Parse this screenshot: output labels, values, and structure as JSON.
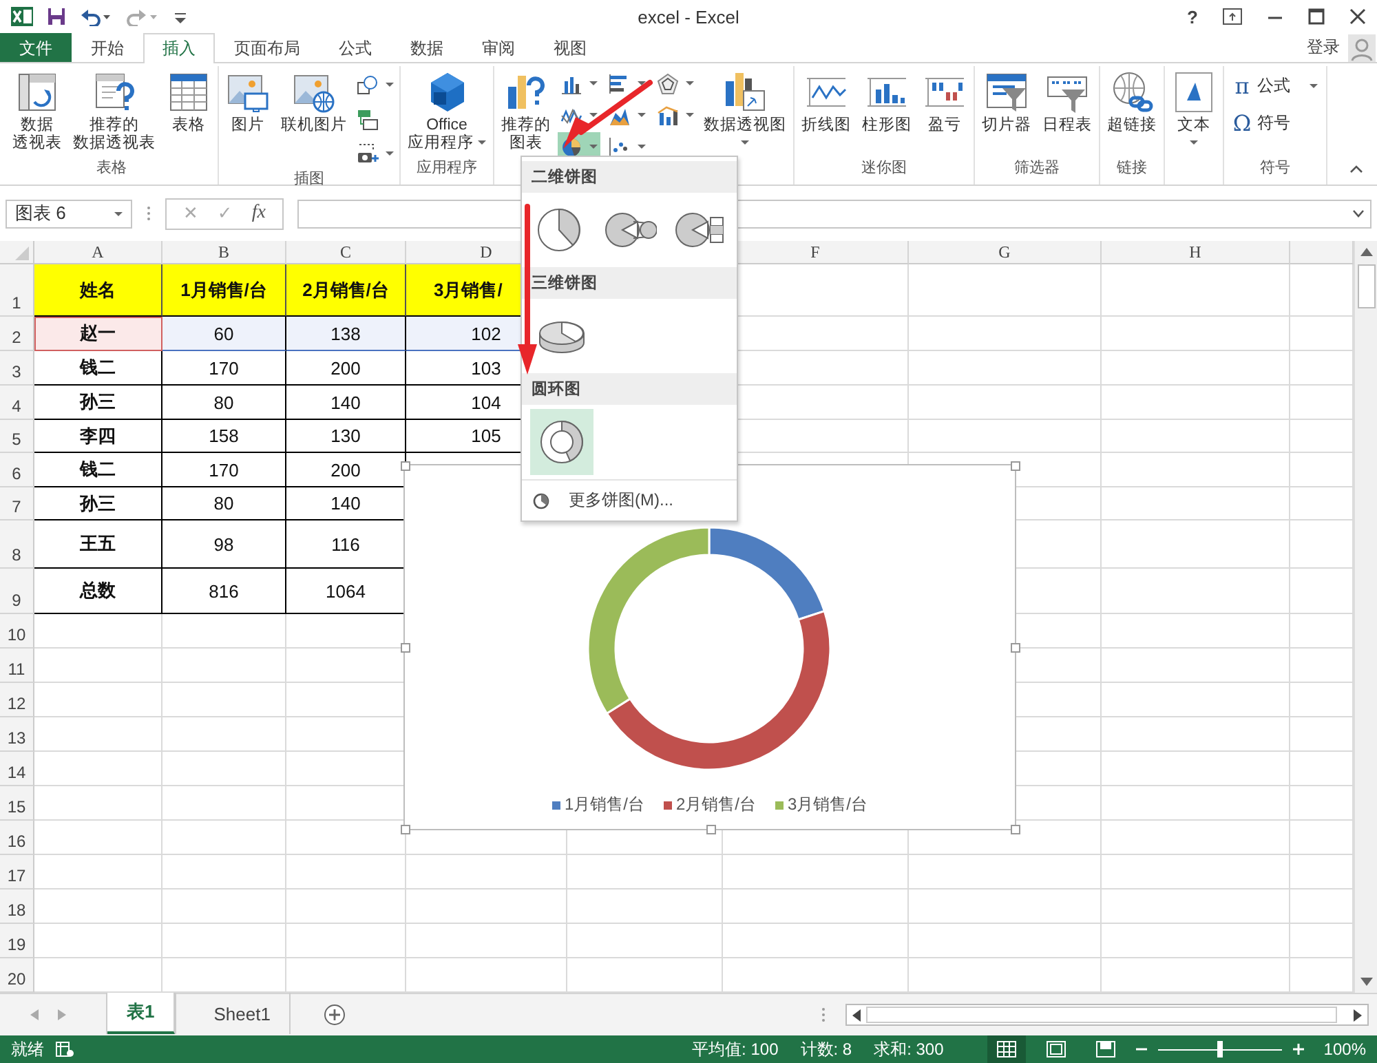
{
  "title_bar": {
    "title": "excel - Excel",
    "help": "?"
  },
  "tabs": [
    {
      "label": "文件",
      "kind": "file",
      "selected": false
    },
    {
      "label": "开始",
      "kind": "tab",
      "selected": false
    },
    {
      "label": "插入",
      "kind": "tab",
      "selected": true
    },
    {
      "label": "页面布局",
      "kind": "tab",
      "selected": false
    },
    {
      "label": "公式",
      "kind": "tab",
      "selected": false
    },
    {
      "label": "数据",
      "kind": "tab",
      "selected": false
    },
    {
      "label": "审阅",
      "kind": "tab",
      "selected": false
    },
    {
      "label": "视图",
      "kind": "tab",
      "selected": false
    }
  ],
  "account": {
    "label": "登录"
  },
  "ribbon": {
    "groups": [
      {
        "label": "表格",
        "controls": [
          {
            "kind": "large",
            "lines": [
              "数据",
              "透视表"
            ],
            "dropdown": false
          },
          {
            "kind": "large",
            "lines": [
              "推荐的",
              "数据透视表"
            ],
            "dropdown": false
          },
          {
            "kind": "large",
            "lines": [
              "表格"
            ],
            "dropdown": false
          }
        ]
      },
      {
        "label": "插图",
        "controls": [
          {
            "kind": "large",
            "lines": [
              "图片"
            ],
            "dropdown": false
          },
          {
            "kind": "large",
            "lines": [
              "联机图片"
            ],
            "dropdown": false
          },
          {
            "kind": "stack",
            "items": [
              {
                "dropdown": true,
                "selected": false
              },
              {
                "dropdown": false,
                "selected": false
              },
              {
                "dropdown": true,
                "selected": false
              }
            ]
          }
        ]
      },
      {
        "label": "应用程序",
        "controls": [
          {
            "kind": "large",
            "lines": [
              "Office",
              "应用程序"
            ],
            "dropdown": true
          }
        ]
      },
      {
        "controls": [
          {
            "kind": "large",
            "lines": [
              "推荐的",
              "图表"
            ],
            "dropdown": false
          },
          {
            "kind": "grid",
            "items": [
              {
                "dropdown": true,
                "selected": false
              },
              {
                "dropdown": true,
                "selected": false
              },
              {
                "dropdown": true,
                "selected": false
              },
              {
                "dropdown": true,
                "selected": false
              },
              {
                "dropdown": true,
                "selected": false
              },
              {
                "dropdown": true,
                "selected": false
              },
              {
                "dropdown": true,
                "selected": true
              },
              {
                "dropdown": true,
                "selected": false
              }
            ]
          },
          {
            "kind": "large",
            "lines": [
              "数据透视图"
            ],
            "dropdown": true
          }
        ]
      },
      {
        "label": "迷你图",
        "controls": [
          {
            "kind": "large",
            "lines": [
              "折线图"
            ],
            "dropdown": false
          },
          {
            "kind": "large",
            "lines": [
              "柱形图"
            ],
            "dropdown": false
          },
          {
            "kind": "large",
            "lines": [
              "盈亏"
            ],
            "dropdown": false
          }
        ]
      },
      {
        "label": "筛选器",
        "controls": [
          {
            "kind": "large",
            "lines": [
              "切片器"
            ],
            "dropdown": false
          },
          {
            "kind": "large",
            "lines": [
              "日程表"
            ],
            "dropdown": false
          }
        ]
      },
      {
        "label": "链接",
        "controls": [
          {
            "kind": "large",
            "lines": [
              "超链接"
            ],
            "dropdown": false
          }
        ]
      },
      {
        "controls": [
          {
            "kind": "large",
            "lines": [
              "文本"
            ],
            "dropdown": true
          }
        ]
      },
      {
        "label": "符号",
        "controls": [
          {
            "kind": "list",
            "items": [
              {
                "symbol": "π",
                "label": "公式",
                "dropdown": true
              },
              {
                "symbol": "Ω",
                "label": "符号",
                "dropdown": false
              }
            ]
          }
        ]
      }
    ]
  },
  "formula_bar": {
    "name_box": "图表 6",
    "cancel": "✕",
    "enter": "✓",
    "function": "fx"
  },
  "columns": [
    {
      "label": "A"
    },
    {
      "label": "B"
    },
    {
      "label": "C"
    },
    {
      "label": "D"
    },
    {},
    {
      "label": "F"
    },
    {
      "label": "G"
    },
    {
      "label": "H"
    },
    {}
  ],
  "rows": [
    {
      "number": "1",
      "kind": "header",
      "cells": [
        {
          "text": "姓名"
        },
        {
          "text": "1月销售/台"
        },
        {
          "text": "2月销售/台"
        },
        {
          "text": "3月销售/"
        }
      ]
    },
    {
      "number": "2",
      "kind": "data",
      "cells": [
        {
          "text": "赵一",
          "in_name_range": true
        },
        {
          "text": "60",
          "in_value_range": true
        },
        {
          "text": "138",
          "in_value_range": true
        },
        {
          "text": "102",
          "in_value_range": true
        }
      ]
    },
    {
      "number": "3",
      "kind": "data",
      "cells": [
        {
          "text": "钱二"
        },
        {
          "text": "170"
        },
        {
          "text": "200"
        },
        {
          "text": "103"
        }
      ]
    },
    {
      "number": "4",
      "kind": "data",
      "cells": [
        {
          "text": "孙三"
        },
        {
          "text": "80"
        },
        {
          "text": "140"
        },
        {
          "text": "104"
        }
      ]
    },
    {
      "number": "5",
      "kind": "data",
      "cells": [
        {
          "text": "李四"
        },
        {
          "text": "158"
        },
        {
          "text": "130"
        },
        {
          "text": "105"
        }
      ]
    },
    {
      "number": "6",
      "kind": "data",
      "cells": [
        {
          "text": "钱二"
        },
        {
          "text": "170"
        },
        {
          "text": "200"
        }
      ]
    },
    {
      "number": "7",
      "kind": "data",
      "cells": [
        {
          "text": "孙三"
        },
        {
          "text": "80"
        },
        {
          "text": "140"
        }
      ]
    },
    {
      "number": "8",
      "kind": "data",
      "cells": [
        {
          "text": "王五"
        },
        {
          "text": "98"
        },
        {
          "text": "116"
        }
      ]
    },
    {
      "number": "9",
      "kind": "data",
      "cells": [
        {
          "text": "总数"
        },
        {
          "text": "816"
        },
        {
          "text": "1064"
        }
      ]
    },
    {
      "number": "10"
    },
    {
      "number": "11"
    },
    {
      "number": "12"
    },
    {
      "number": "13"
    },
    {
      "number": "14"
    },
    {
      "number": "15"
    },
    {
      "number": "16"
    },
    {
      "number": "17"
    },
    {
      "number": "18"
    },
    {
      "number": "19"
    },
    {
      "number": "20"
    }
  ],
  "chart": {
    "slices": [
      {
        "color": "#4f7ec0"
      },
      {
        "color": "#c0504d"
      },
      {
        "color": "#9bbb59"
      }
    ],
    "chart_data": {
      "type": "donut",
      "categories": [
        "1月销售/台",
        "2月销售/台",
        "3月销售/台"
      ],
      "values": [
        20,
        46,
        34
      ]
    }
  },
  "chart_menu": {
    "sections": [
      {
        "title": "二维饼图",
        "items": [
          {
            "selected": false
          },
          {
            "selected": false
          },
          {
            "selected": false
          }
        ]
      },
      {
        "title": "三维饼图",
        "items": [
          {
            "selected": false
          }
        ]
      },
      {
        "title": "圆环图",
        "items": [
          {
            "selected": true
          }
        ]
      }
    ],
    "more": "更多饼图(M)..."
  },
  "sheet_tabs": [
    {
      "label": "表1",
      "selected": true
    },
    {
      "label": "Sheet1",
      "selected": false
    }
  ],
  "status_bar": {
    "mode": "就绪",
    "stats": [
      "平均值: 100",
      "计数: 8",
      "求和: 300"
    ],
    "views": [
      {
        "selected": true
      },
      {
        "selected": false
      },
      {
        "selected": false
      }
    ],
    "zoom": {
      "level": 0.5,
      "reading": "100%"
    }
  }
}
